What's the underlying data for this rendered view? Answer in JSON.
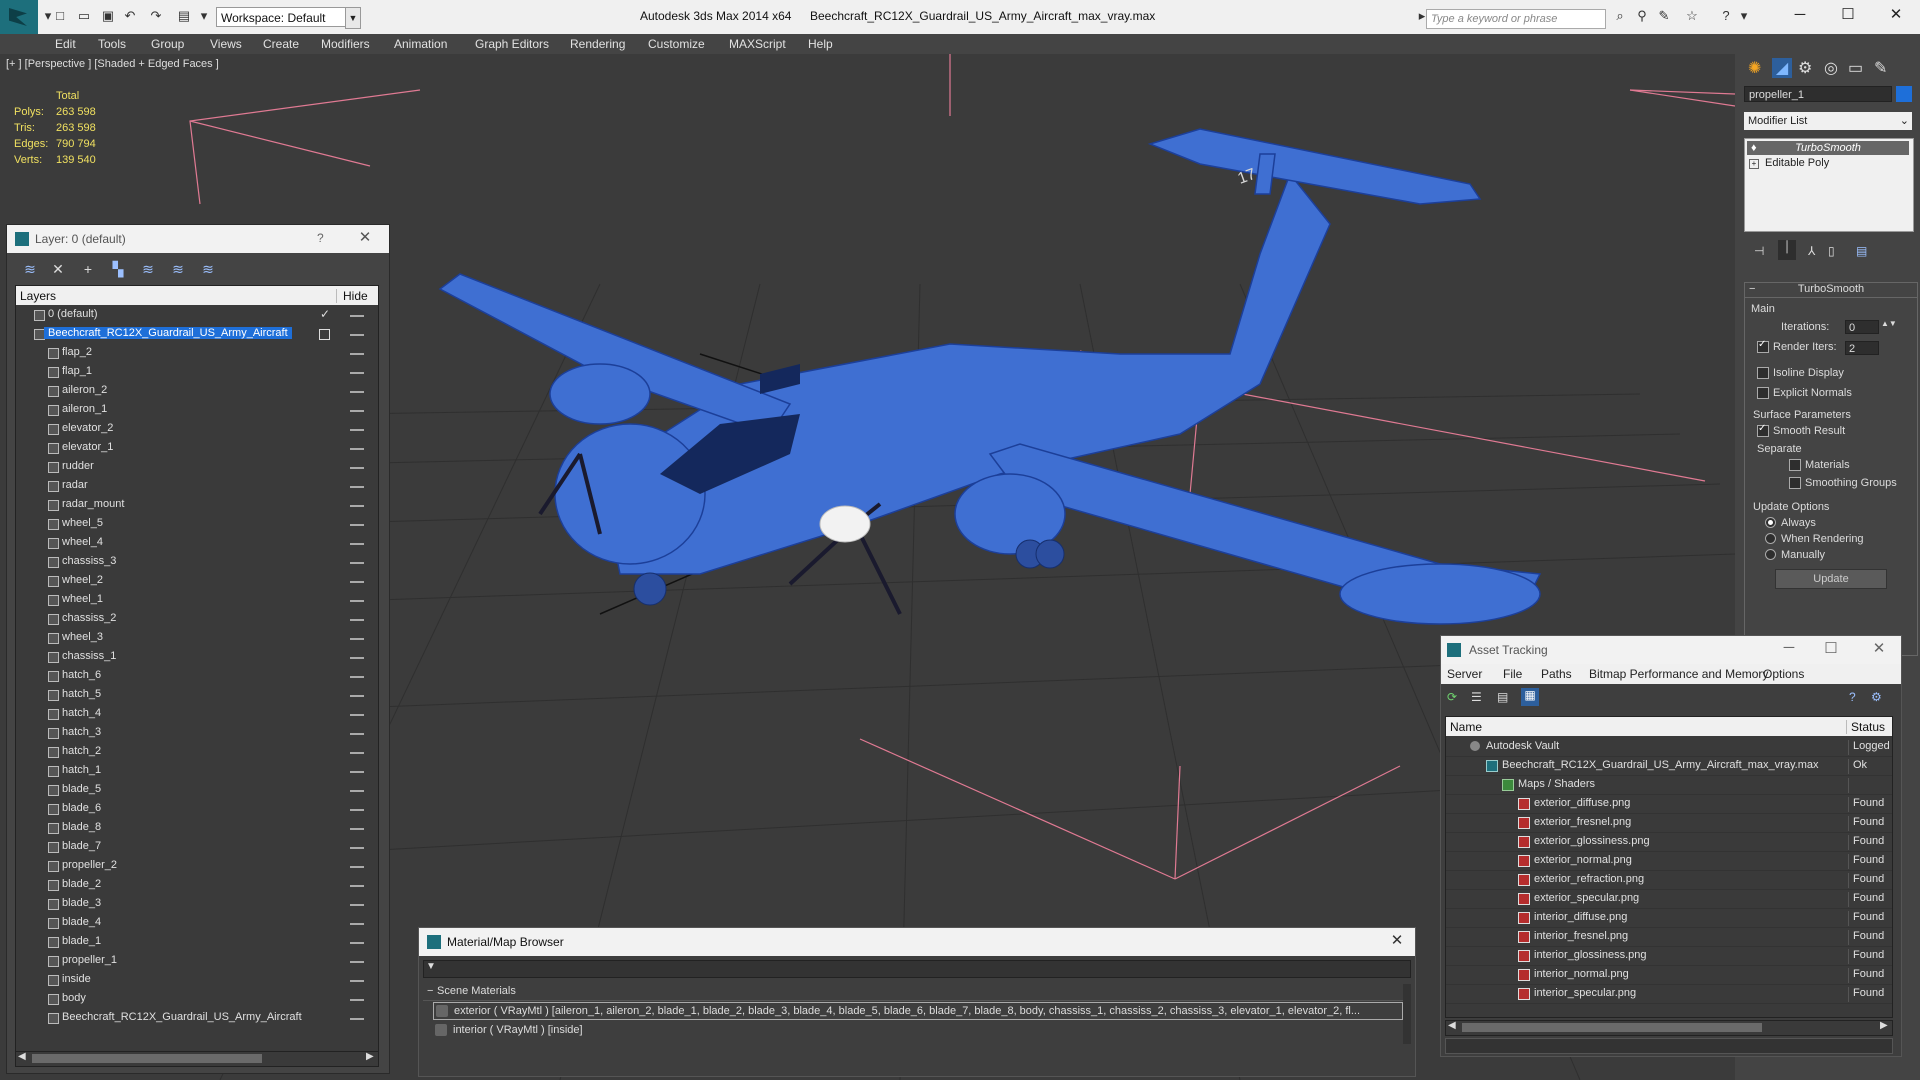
{
  "titlebar": {
    "workspace": "Workspace: Default",
    "app_title": "Autodesk 3ds Max  2014 x64",
    "file_title": "Beechcraft_RC12X_Guardrail_US_Army_Aircraft_max_vray.max",
    "search_placeholder": "Type a keyword or phrase"
  },
  "menu": [
    "Edit",
    "Tools",
    "Group",
    "Views",
    "Create",
    "Modifiers",
    "Animation",
    "Graph Editors",
    "Rendering",
    "Customize",
    "MAXScript",
    "Help"
  ],
  "viewport": {
    "label": "[+ ] [Perspective ] [Shaded + Edged Faces ]",
    "stats": {
      "header": "Total",
      "rows": [
        {
          "label": "Polys:",
          "value": "263 598"
        },
        {
          "label": "Tris:",
          "value": "263 598"
        },
        {
          "label": "Edges:",
          "value": "790 794"
        },
        {
          "label": "Verts:",
          "value": "139 540"
        }
      ]
    },
    "tail_text": "17"
  },
  "layer_panel": {
    "title": "Layer: 0 (default)",
    "help": "?",
    "col_layers": "Layers",
    "col_hide": "Hide",
    "rows": [
      {
        "name": "0 (default)",
        "level": 0
      },
      {
        "name": "Beechcraft_RC12X_Guardrail_US_Army_Aircraft",
        "level": 0
      },
      {
        "name": "flap_2",
        "level": 1
      },
      {
        "name": "flap_1",
        "level": 1
      },
      {
        "name": "aileron_2",
        "level": 1
      },
      {
        "name": "aileron_1",
        "level": 1
      },
      {
        "name": "elevator_2",
        "level": 1
      },
      {
        "name": "elevator_1",
        "level": 1
      },
      {
        "name": "rudder",
        "level": 1
      },
      {
        "name": "radar",
        "level": 1
      },
      {
        "name": "radar_mount",
        "level": 1
      },
      {
        "name": "wheel_5",
        "level": 1
      },
      {
        "name": "wheel_4",
        "level": 1
      },
      {
        "name": "chassiss_3",
        "level": 1
      },
      {
        "name": "wheel_2",
        "level": 1
      },
      {
        "name": "wheel_1",
        "level": 1
      },
      {
        "name": "chassiss_2",
        "level": 1
      },
      {
        "name": "wheel_3",
        "level": 1
      },
      {
        "name": "chassiss_1",
        "level": 1
      },
      {
        "name": "hatch_6",
        "level": 1
      },
      {
        "name": "hatch_5",
        "level": 1
      },
      {
        "name": "hatch_4",
        "level": 1
      },
      {
        "name": "hatch_3",
        "level": 1
      },
      {
        "name": "hatch_2",
        "level": 1
      },
      {
        "name": "hatch_1",
        "level": 1
      },
      {
        "name": "blade_5",
        "level": 1
      },
      {
        "name": "blade_6",
        "level": 1
      },
      {
        "name": "blade_8",
        "level": 1
      },
      {
        "name": "blade_7",
        "level": 1
      },
      {
        "name": "propeller_2",
        "level": 1
      },
      {
        "name": "blade_2",
        "level": 1
      },
      {
        "name": "blade_3",
        "level": 1
      },
      {
        "name": "blade_4",
        "level": 1
      },
      {
        "name": "blade_1",
        "level": 1
      },
      {
        "name": "propeller_1",
        "level": 1
      },
      {
        "name": "inside",
        "level": 1
      },
      {
        "name": "body",
        "level": 1
      },
      {
        "name": "Beechcraft_RC12X_Guardrail_US_Army_Aircraft",
        "level": 1
      }
    ]
  },
  "cmd_panel": {
    "object_name": "propeller_1",
    "modifier_list": "Modifier List",
    "stack": [
      "TurboSmooth",
      "Editable Poly"
    ],
    "rollout_title": "TurboSmooth",
    "main": "Main",
    "iterations_label": "Iterations:",
    "iterations_value": "0",
    "render_iters_label": "Render Iters:",
    "render_iters_value": "2",
    "isoline": "Isoline Display",
    "explicit": "Explicit Normals",
    "surface_params": "Surface Parameters",
    "smooth_result": "Smooth Result",
    "separate": "Separate",
    "materials": "Materials",
    "smoothing_groups": "Smoothing Groups",
    "update_options": "Update Options",
    "always": "Always",
    "when_rendering": "When Rendering",
    "manually": "Manually",
    "update_btn": "Update"
  },
  "material_browser": {
    "title": "Material/Map Browser",
    "section": "Scene Materials",
    "items": [
      "exterior  ( VRayMtl )  [aileron_1, aileron_2, blade_1, blade_2, blade_3, blade_4, blade_5, blade_6, blade_7, blade_8, body, chassiss_1, chassiss_2, chassiss_3, elevator_1, elevator_2, fl...",
      "interior  ( VRayMtl )  [inside]"
    ]
  },
  "asset_tracking": {
    "title": "Asset Tracking",
    "menu": [
      "Server",
      "File",
      "Paths",
      "Bitmap Performance and Memory",
      "Options"
    ],
    "col_name": "Name",
    "col_status": "Status",
    "rows": [
      {
        "name": "Autodesk Vault",
        "status": "Logged O",
        "indent": 1,
        "kind": "vault"
      },
      {
        "name": "Beechcraft_RC12X_Guardrail_US_Army_Aircraft_max_vray.max",
        "status": "Ok",
        "indent": 2,
        "kind": "max"
      },
      {
        "name": "Maps / Shaders",
        "status": "",
        "indent": 3,
        "kind": "folder"
      },
      {
        "name": "exterior_diffuse.png",
        "status": "Found",
        "indent": 4,
        "kind": "png"
      },
      {
        "name": "exterior_fresnel.png",
        "status": "Found",
        "indent": 4,
        "kind": "png"
      },
      {
        "name": "exterior_glossiness.png",
        "status": "Found",
        "indent": 4,
        "kind": "png"
      },
      {
        "name": "exterior_normal.png",
        "status": "Found",
        "indent": 4,
        "kind": "png"
      },
      {
        "name": "exterior_refraction.png",
        "status": "Found",
        "indent": 4,
        "kind": "png"
      },
      {
        "name": "exterior_specular.png",
        "status": "Found",
        "indent": 4,
        "kind": "png"
      },
      {
        "name": "interior_diffuse.png",
        "status": "Found",
        "indent": 4,
        "kind": "png"
      },
      {
        "name": "interior_fresnel.png",
        "status": "Found",
        "indent": 4,
        "kind": "png"
      },
      {
        "name": "interior_glossiness.png",
        "status": "Found",
        "indent": 4,
        "kind": "png"
      },
      {
        "name": "interior_normal.png",
        "status": "Found",
        "indent": 4,
        "kind": "png"
      },
      {
        "name": "interior_specular.png",
        "status": "Found",
        "indent": 4,
        "kind": "png"
      }
    ]
  },
  "colors": {
    "selection": "#1e6fd9",
    "stats_yellow": "#f0e060",
    "wire_blue": "#2a5fd6"
  }
}
